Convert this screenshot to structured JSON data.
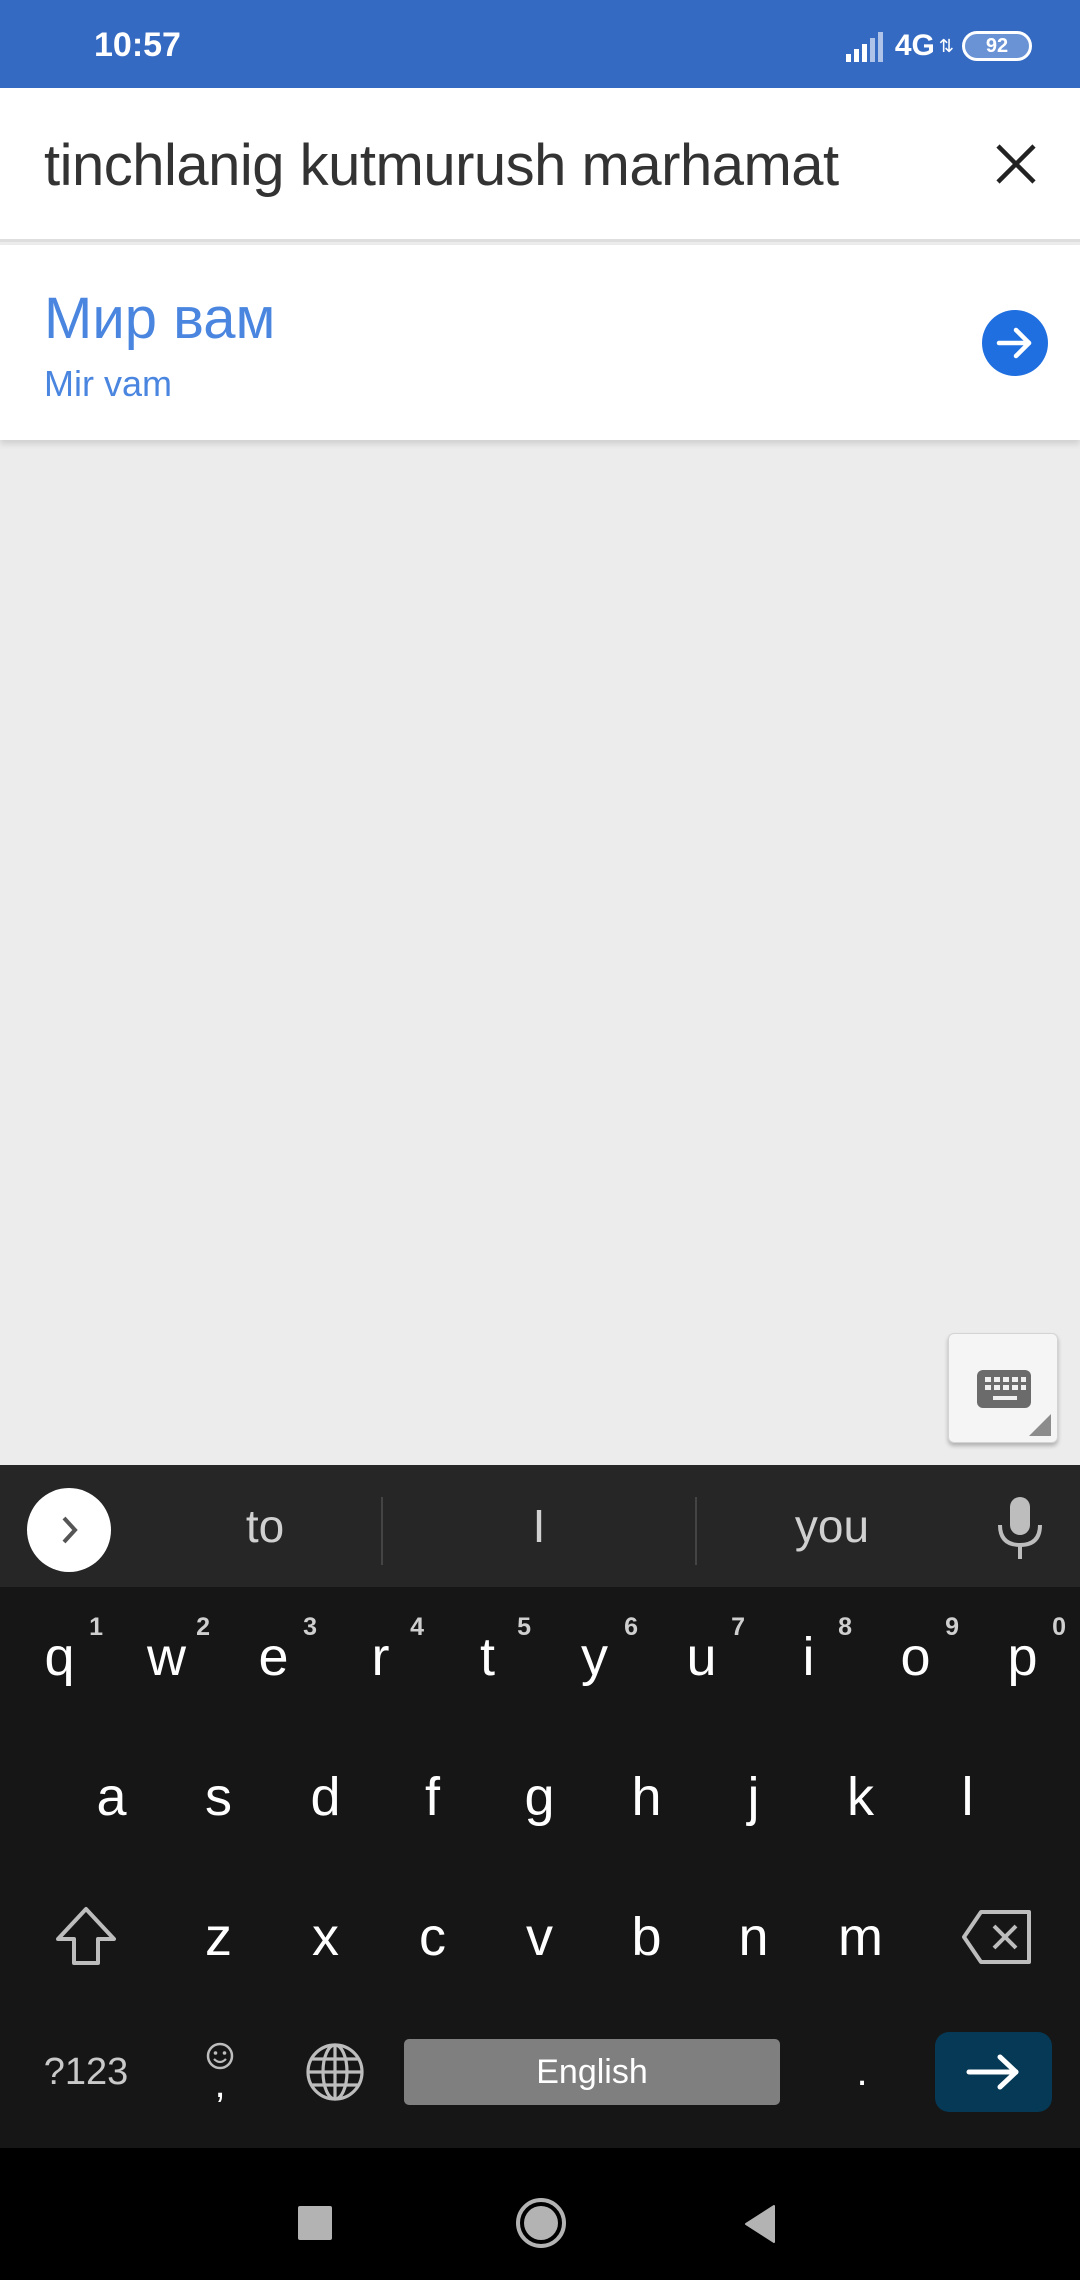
{
  "status_bar": {
    "time": "10:57",
    "network": "4G",
    "battery": "92",
    "background_color": "#356ac3"
  },
  "search": {
    "query": "tinchlanig kutmurush marhamat",
    "clear_icon": "close-icon"
  },
  "result": {
    "translation": "Мир вам",
    "transliteration": "Mir vam",
    "go_icon": "arrow-right-icon",
    "accent_color": "#4a86e0"
  },
  "floating_keyboard_button": {
    "icon": "keyboard-icon"
  },
  "keyboard": {
    "suggestions": [
      "to",
      "I",
      "you"
    ],
    "expand_icon": "chevron-right-icon",
    "mic_icon": "microphone-icon",
    "rows": [
      [
        {
          "key": "q",
          "hint": "1"
        },
        {
          "key": "w",
          "hint": "2"
        },
        {
          "key": "e",
          "hint": "3"
        },
        {
          "key": "r",
          "hint": "4"
        },
        {
          "key": "t",
          "hint": "5"
        },
        {
          "key": "y",
          "hint": "6"
        },
        {
          "key": "u",
          "hint": "7"
        },
        {
          "key": "i",
          "hint": "8"
        },
        {
          "key": "o",
          "hint": "9"
        },
        {
          "key": "p",
          "hint": "0"
        }
      ],
      [
        {
          "key": "a"
        },
        {
          "key": "s"
        },
        {
          "key": "d"
        },
        {
          "key": "f"
        },
        {
          "key": "g"
        },
        {
          "key": "h"
        },
        {
          "key": "j"
        },
        {
          "key": "k"
        },
        {
          "key": "l"
        }
      ],
      [
        {
          "key": "z"
        },
        {
          "key": "x"
        },
        {
          "key": "c"
        },
        {
          "key": "v"
        },
        {
          "key": "b"
        },
        {
          "key": "n"
        },
        {
          "key": "m"
        }
      ]
    ],
    "shift_icon": "shift-icon",
    "backspace_icon": "backspace-icon",
    "symbols_label": "?123",
    "comma_label": ",",
    "emoji_icon": "emoji-icon",
    "globe_icon": "globe-icon",
    "space_label": "English",
    "period_label": ".",
    "enter_icon": "arrow-right-icon",
    "enter_color": "#053956"
  },
  "nav_bar": {
    "recents_icon": "square-icon",
    "home_icon": "circle-icon",
    "back_icon": "triangle-back-icon"
  }
}
